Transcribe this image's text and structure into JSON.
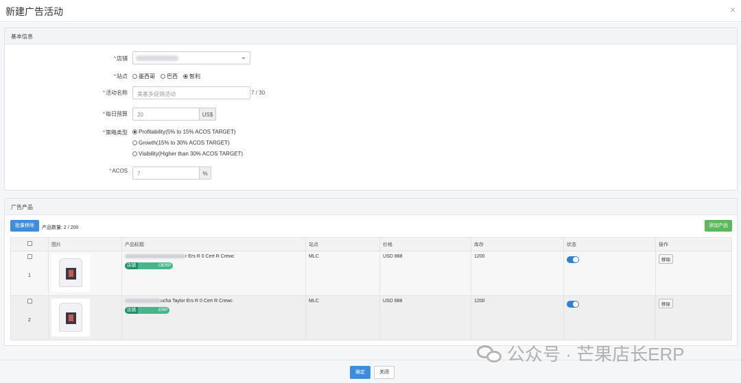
{
  "modal": {
    "title": "新建广告活动",
    "close_icon": "×"
  },
  "basic_panel": {
    "title": "基本信息",
    "store": {
      "label": "店铺"
    },
    "site": {
      "label": "站点",
      "options": [
        "墨西哥",
        "巴西",
        "智利"
      ],
      "selected": "智利"
    },
    "name": {
      "label": "活动名称",
      "placeholder": "美客多促销活动",
      "counter": "7 / 30"
    },
    "budget": {
      "label": "每日预算",
      "value": "20",
      "unit": "US$"
    },
    "strategy": {
      "label": "策略类型",
      "options": [
        "Profitability(5% to 15% ACOS TARGET)",
        "Growth(15% to 30% ACOS TARGET)",
        "Visibility(Higher than 30% ACOS TARGET)"
      ],
      "selected": "Profitability(5% to 15% ACOS TARGET)"
    },
    "acos": {
      "label": "ACOS",
      "value": "7",
      "unit": "%"
    }
  },
  "products_panel": {
    "title": "广告产品",
    "batch_remove": "批量移除",
    "count_label": "产品数量:",
    "count_value": "2 / 200",
    "add_product": "添加产品",
    "columns": [
      "图片",
      "产品标题",
      "站点",
      "价格",
      "库存",
      "状态",
      "操作"
    ],
    "rows": [
      {
        "index": "1",
        "title_suffix": "r Ers R 0 Cert R Crewc",
        "tag_label": "店铺",
        "tag_suffix": "OERP",
        "site": "MLC",
        "price": "USD 888",
        "stock": "1200",
        "status": true,
        "action": "移除"
      },
      {
        "index": "2",
        "title_suffix": "ucha Taylor Ers R 0 Cert R Crewc",
        "tag_label": "店铺",
        "tag_suffix": "ERP",
        "site": "MLC",
        "price": "USD 888",
        "stock": "1200",
        "status": true,
        "action": "移除"
      }
    ]
  },
  "footer": {
    "confirm": "确定",
    "close": "关闭"
  },
  "watermark": {
    "text": "公众号 · 芒果店长ERP"
  }
}
